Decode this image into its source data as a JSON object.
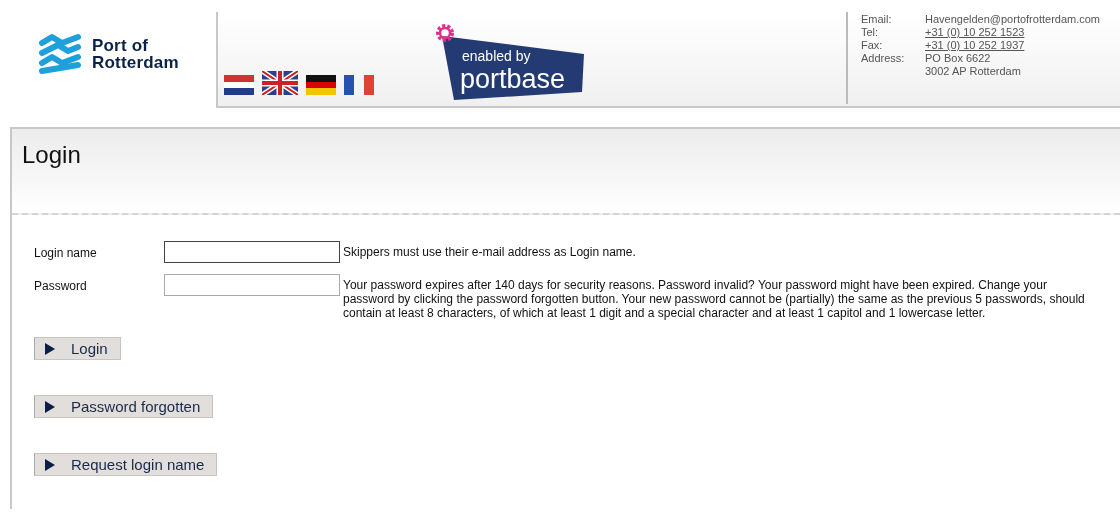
{
  "brand": {
    "line_1": "Port of",
    "line_2": "Rotterdam"
  },
  "languages": [
    {
      "kind": "nl"
    },
    {
      "kind": "gb"
    },
    {
      "kind": "de"
    },
    {
      "kind": "fr"
    }
  ],
  "badge": {
    "line_1": "enabled by",
    "line_2": "portbase"
  },
  "contact": [
    {
      "label": "Email:",
      "value": "Havengelden@portofrotterdam.com",
      "link": false
    },
    {
      "label": "Tel:",
      "value": "+31 (0) 10 252 1523",
      "link": true
    },
    {
      "label": "Fax:",
      "value": "+31 (0) 10 252 1937",
      "link": true
    },
    {
      "label": "Address:",
      "value": "PO Box 6622",
      "link": false
    },
    {
      "value": "3002 AP  Rotterdam",
      "link": false
    }
  ],
  "page_title": "Login",
  "fields": [
    {
      "label": "Login name",
      "kind": "text",
      "hint": "Skippers must use their e-mail address as Login name."
    },
    {
      "label": "Password",
      "kind": "password",
      "hint": "Your password expires after 140 days for security reasons. Password invalid? Your password might have been expired. Change your password by clicking the password forgotten button. Your new password cannot be (partially) the same as the previous 5 passwords, should contain at least 8 characters, of which at least 1 digit and a special character and at least 1 capitol and 1 lowercase letter."
    }
  ],
  "buttons": [
    "Login",
    "Password forgotten",
    "Request login name"
  ]
}
